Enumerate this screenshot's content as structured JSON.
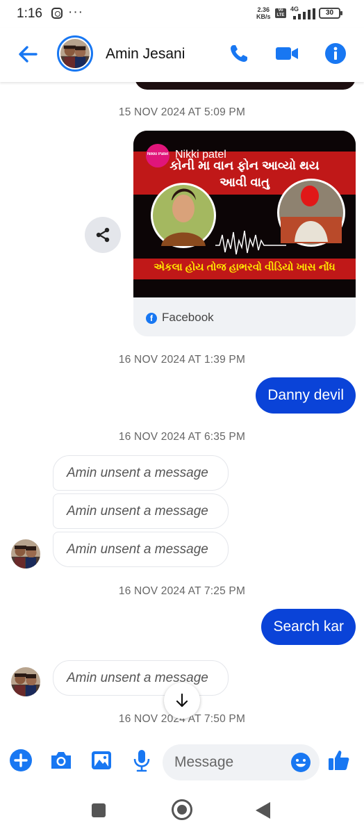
{
  "status_bar": {
    "time": "1:16",
    "net_speed": "2.36",
    "net_speed_unit": "KB/s",
    "volte": "Vo LTE",
    "network": "4G",
    "battery": "30"
  },
  "header": {
    "contact_name": "Amin Jesani",
    "accent_color": "#1877f2"
  },
  "messages": {
    "timestamps": [
      "15 NOV 2024 AT 5:09 PM",
      "16 NOV 2024 AT 1:39 PM",
      "16 NOV 2024 AT 6:35 PM",
      "16 NOV 2024 AT 7:25 PM",
      "16 NOV 2024 AT 7:50 PM"
    ],
    "shared_post": {
      "source": "Facebook",
      "thumb_badge": "Nikki Patel",
      "thumb_author": "Nikki patel",
      "thumb_title_line1": "કોની મા વાન ફોન આવ્યો થય",
      "thumb_title_line2": "આવી વાતુ",
      "thumb_caption": "એકલા હોય તોજ હાભરવો વીડિયો ખાસ નોંધ"
    },
    "outgoing": [
      "Danny devil",
      "Search kar"
    ],
    "unsent_text": "Amin unsent a message"
  },
  "composer": {
    "placeholder": "Message"
  },
  "colors": {
    "outgoing_bubble": "#0a43d8",
    "icon_blue": "#1877f2"
  },
  "icons": [
    "arrow-left-icon",
    "phone-icon",
    "video-camera-icon",
    "info-icon",
    "share-icon",
    "facebook-icon",
    "arrow-down-icon",
    "plus-circle-icon",
    "camera-icon",
    "image-icon",
    "microphone-icon",
    "emoji-icon",
    "thumbs-up-icon"
  ]
}
